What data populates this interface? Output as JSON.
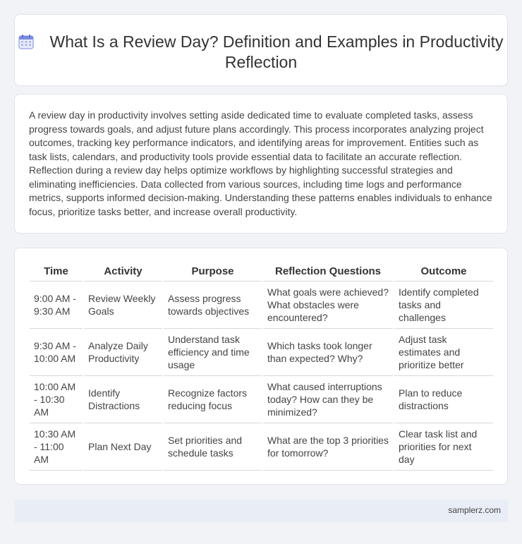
{
  "header": {
    "title": "What Is a Review Day? Definition and Examples in Productivity Reflection",
    "icon": "calendar-icon"
  },
  "intro": {
    "text": "A review day in productivity involves setting aside dedicated time to evaluate completed tasks, assess progress towards goals, and adjust future plans accordingly. This process incorporates analyzing project outcomes, tracking key performance indicators, and identifying areas for improvement. Entities such as task lists, calendars, and productivity tools provide essential data to facilitate an accurate reflection. Reflection during a review day helps optimize workflows by highlighting successful strategies and eliminating inefficiencies. Data collected from various sources, including time logs and performance metrics, supports informed decision-making. Understanding these patterns enables individuals to enhance focus, prioritize tasks better, and increase overall productivity."
  },
  "table": {
    "headers": [
      "Time",
      "Activity",
      "Purpose",
      "Reflection Questions",
      "Outcome"
    ],
    "rows": [
      [
        "9:00 AM - 9:30 AM",
        "Review Weekly Goals",
        "Assess progress towards objectives",
        "What goals were achieved? What obstacles were encountered?",
        "Identify completed tasks and challenges"
      ],
      [
        "9:30 AM - 10:00 AM",
        "Analyze Daily Productivity",
        "Understand task efficiency and time usage",
        "Which tasks took longer than expected? Why?",
        "Adjust task estimates and prioritize better"
      ],
      [
        "10:00 AM - 10:30 AM",
        "Identify Distractions",
        "Recognize factors reducing focus",
        "What caused interruptions today? How can they be minimized?",
        "Plan to reduce distractions"
      ],
      [
        "10:30 AM - 11:00 AM",
        "Plan Next Day",
        "Set priorities and schedule tasks",
        "What are the top 3 priorities for tomorrow?",
        "Clear task list and priorities for next day"
      ]
    ]
  },
  "footer": {
    "text": "samplerz.com"
  },
  "colors": {
    "background": "#f1f3f6",
    "card": "#ffffff",
    "footer": "#e9edf5",
    "icon_accent": "#7c8be0"
  }
}
